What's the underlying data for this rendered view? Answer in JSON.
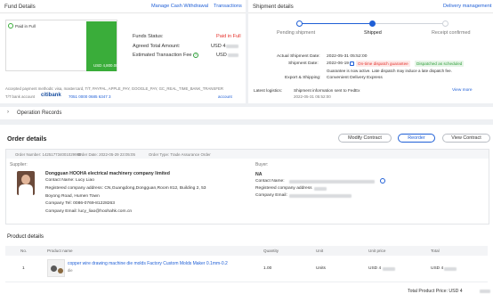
{
  "fund": {
    "title": "Fund Details",
    "manage_link": "Manage Cash Withdrawal",
    "transactions_link": "Transactions",
    "paid_badge": "Paid in Full",
    "bar_amount": "USD 4,800.00",
    "status_label": "Funds Status:",
    "status_value": "Paid in Full",
    "agreed_label": "Agreed Total Amount:",
    "agreed_value": "USD 4",
    "fee_label": "Estimated Transaction Fee",
    "fee_value": "USD",
    "payment_methods": "Accepted payment methods: visa, mastercard, T/T, PAYPAL, APPLE_PAY, GOOGLE_PAY, GC_REAL_TIME_BANK_TRANSFER",
    "bank_label": "T/T bank account",
    "bank_name": "citibank",
    "bank_number": "7051 0000 0685 6347 3",
    "account_link": "account"
  },
  "shipment": {
    "title": "Shipment details",
    "delivery_link": "Delivery management",
    "steps": [
      "Pending shipment",
      "Shipped",
      "Receipt confirmed"
    ],
    "actual_date_label": "Actual Shipment Date:",
    "actual_date_value": "2022-05-31 05:52:00",
    "shipment_date_label": "Shipment Date:",
    "shipment_date_value": "2022-06-19",
    "ontime_tag": "On-time dispatch guarantee",
    "dispatched_tag": "Dispatched as scheduled",
    "guarantee_note": "Guarantee is now active. Late dispatch may induce a late dispatch fee.",
    "export_label": "Export & Shipping:",
    "export_value": "Convenient Delivery Express",
    "logistics_label": "Latest logistics:",
    "logistics_text": "Shipment information sent to FedEx",
    "logistics_date": "2022-05-31 05:52:00",
    "view_more": "View more"
  },
  "operation_records": "Operation Records",
  "order": {
    "title": "Order details",
    "modify_btn": "Modify Contract",
    "reorder_btn": "Reorder",
    "view_btn": "View Contract",
    "order_number": "Order Number: 142517734001029990",
    "order_date": "Order Date: 2022-05-29 23:05:05",
    "order_type": "Order Type: Trade Assurance Order",
    "supplier_label": "Supplier:",
    "supplier_name": "Dongguan HOOHA electrical machinery company limited",
    "supplier_contact": "Contact Name: Lucy Liao",
    "supplier_address_1": "Registered company address: CN,Guangdong,Dongguan,Room 812, Building 2, 53",
    "supplier_address_2": "Boyong Road, Humen Town",
    "supplier_tel": "Company Tel: 0086-0769-81228263",
    "supplier_email": "Company Email: lucy_liao@hoohahk.com.cn",
    "buyer_label": "Buyer:",
    "buyer_name": "NA",
    "buyer_contact": "Contact Name:",
    "buyer_address": "Registered company address",
    "buyer_email": "Company Email:"
  },
  "product": {
    "title": "Product details",
    "columns": [
      "No.",
      "Product name",
      "Quantity",
      "Unit",
      "Unit price",
      "Total"
    ],
    "rows": [
      {
        "no": "1",
        "name": "copper wire drawing machine die molds Factory Custom Molds Maker 0.1mm-0.2",
        "sub": "die",
        "qty": "1.00",
        "unit": "Units",
        "price": "USD 4",
        "total": "USD 4"
      }
    ],
    "total_label": "Total Product Price: USD 4"
  },
  "colors": {
    "accent": "#1f5fd6",
    "bar_green": "#3aad3a",
    "alert_red": "#e5312b"
  }
}
